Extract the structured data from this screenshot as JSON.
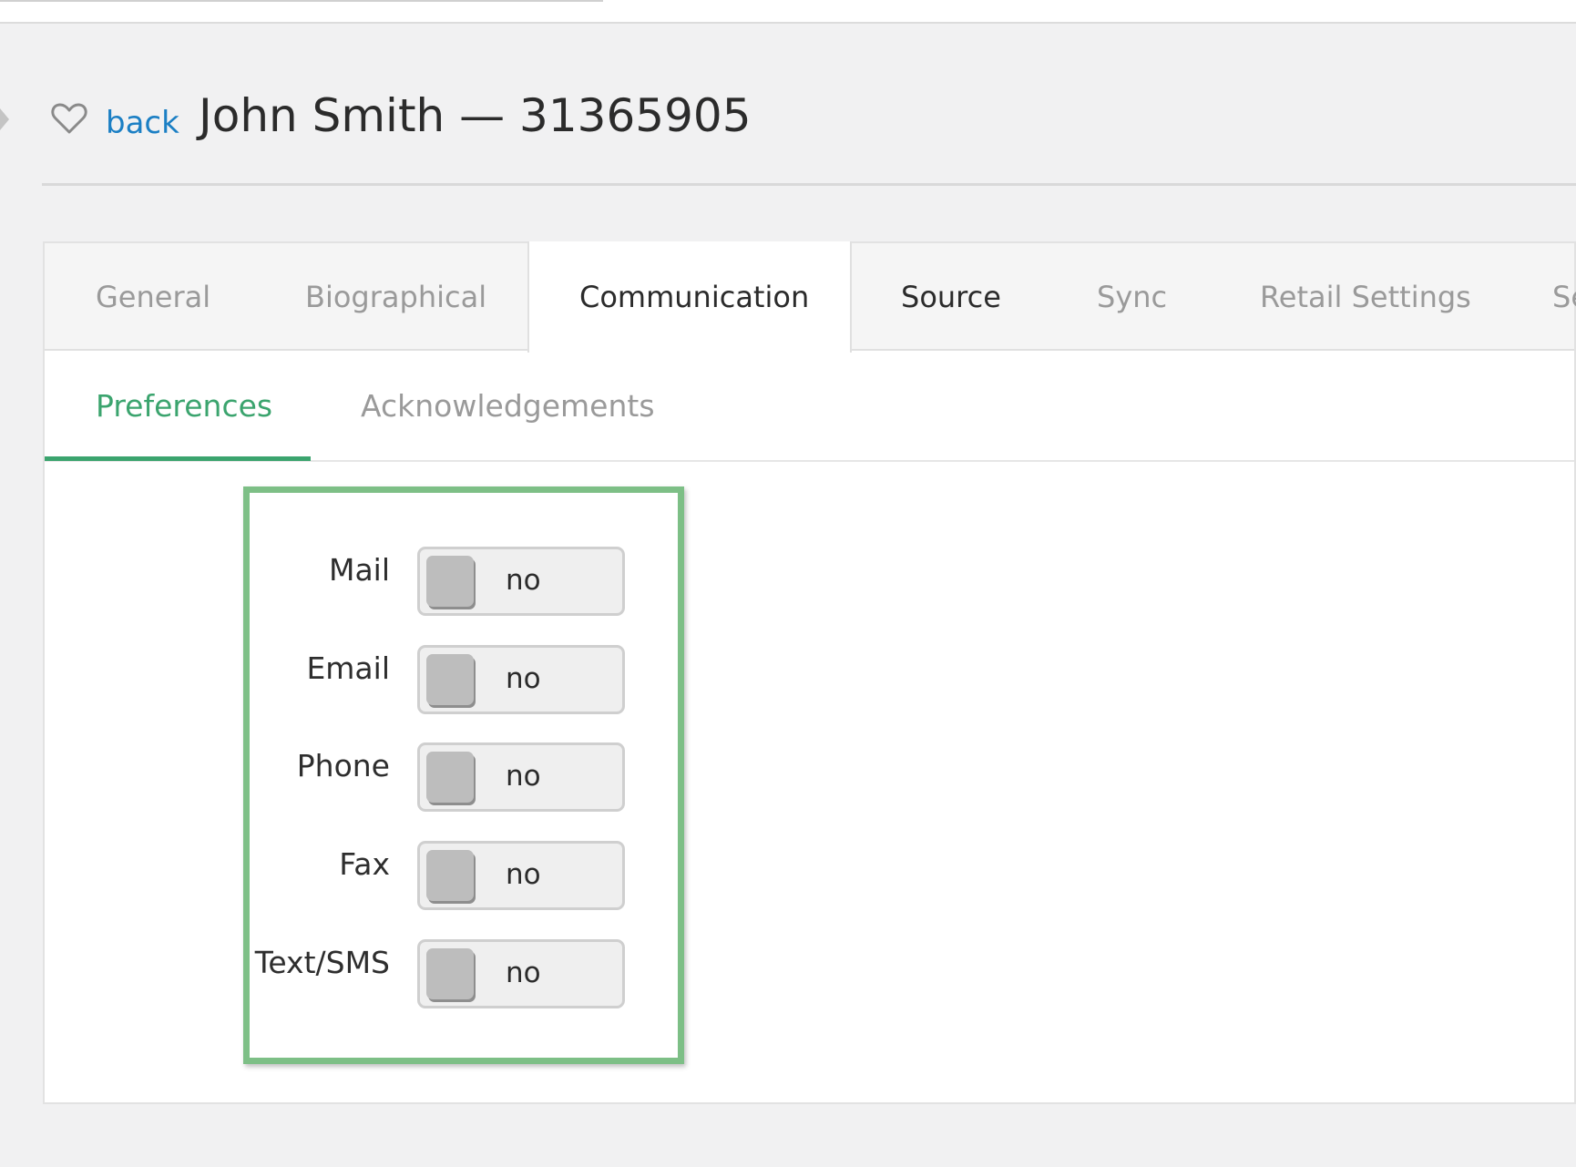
{
  "header": {
    "back_label": "back",
    "title": "John Smith — 31365905"
  },
  "tabs": [
    {
      "label": "General"
    },
    {
      "label": "Biographical"
    },
    {
      "label": "Communication",
      "active": true
    },
    {
      "label": "Source"
    },
    {
      "label": "Sync"
    },
    {
      "label": "Retail Settings"
    },
    {
      "label": "Se"
    }
  ],
  "subtabs": [
    {
      "label": "Preferences",
      "active": true
    },
    {
      "label": "Acknowledgements"
    }
  ],
  "preferences": [
    {
      "label": "Mail",
      "value": "no"
    },
    {
      "label": "Email",
      "value": "no"
    },
    {
      "label": "Phone",
      "value": "no"
    },
    {
      "label": "Fax",
      "value": "no"
    },
    {
      "label": "Text/SMS",
      "value": "no"
    }
  ],
  "colors": {
    "accent_green": "#3ba46e",
    "highlight_border": "#7dbf86",
    "link_blue": "#1b7fc4"
  }
}
